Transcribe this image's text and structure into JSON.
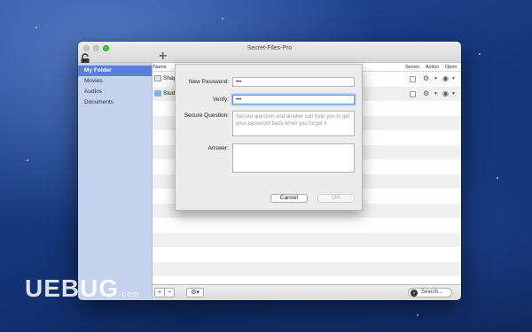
{
  "window": {
    "title": "Secret-Files-Pro"
  },
  "sidebar": {
    "items": [
      {
        "label": "My Folder"
      },
      {
        "label": "Movies"
      },
      {
        "label": "Audios"
      },
      {
        "label": "Documents"
      }
    ]
  },
  "list": {
    "columns": {
      "name": "Name",
      "secret": "Secret",
      "action": "Action",
      "open": "Open"
    },
    "rows": [
      {
        "name": "Shap"
      },
      {
        "name": "Study"
      }
    ]
  },
  "dialog": {
    "new_password_label": "New Password:",
    "new_password_value": "•••",
    "verify_label": "Verify:",
    "verify_value": "•••",
    "secure_question_label": "Secure Question:",
    "secure_question_placeholder": "Secure question and answer can help you to get your password back when you forget it.",
    "answer_label": "Answer:",
    "cancel_label": "Cancel",
    "ok_label": "OK"
  },
  "bottombar": {
    "search_label": "Search..."
  },
  "watermark": {
    "text": "UEBUG",
    "sub": ".com"
  },
  "colors": {
    "accent": "#5b7fd3",
    "sidebar_bg": "#c6d3ee",
    "focus_ring": "#5e9ded"
  }
}
